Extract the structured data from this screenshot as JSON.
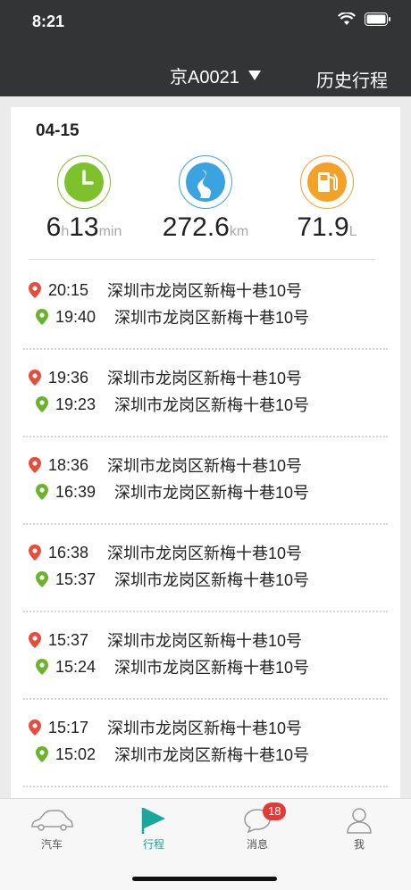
{
  "status": {
    "time": "8:21"
  },
  "header": {
    "vehicle": "京A0021",
    "history": "历史行程"
  },
  "summary": {
    "date": "04-15",
    "duration_h": "6",
    "duration_h_unit": "h",
    "duration_m": "13",
    "duration_m_unit": "min",
    "distance": "272.6",
    "distance_unit": "km",
    "fuel": "71.9",
    "fuel_unit": "L"
  },
  "trips": [
    {
      "end_time": "20:15",
      "end_addr": "深圳市龙岗区新梅十巷10号",
      "start_time": "19:40",
      "start_addr": "深圳市龙岗区新梅十巷10号"
    },
    {
      "end_time": "19:36",
      "end_addr": "深圳市龙岗区新梅十巷10号",
      "start_time": "19:23",
      "start_addr": "深圳市龙岗区新梅十巷10号"
    },
    {
      "end_time": "18:36",
      "end_addr": "深圳市龙岗区新梅十巷10号",
      "start_time": "16:39",
      "start_addr": "深圳市龙岗区新梅十巷10号"
    },
    {
      "end_time": "16:38",
      "end_addr": "深圳市龙岗区新梅十巷10号",
      "start_time": "15:37",
      "start_addr": "深圳市龙岗区新梅十巷10号"
    },
    {
      "end_time": "15:37",
      "end_addr": "深圳市龙岗区新梅十巷10号",
      "start_time": "15:24",
      "start_addr": "深圳市龙岗区新梅十巷10号"
    },
    {
      "end_time": "15:17",
      "end_addr": "深圳市龙岗区新梅十巷10号",
      "start_time": "15:02",
      "start_addr": "深圳市龙岗区新梅十巷10号"
    }
  ],
  "tabs": {
    "car": "汽车",
    "trip": "行程",
    "messages": "消息",
    "messages_badge": "18",
    "me": "我"
  },
  "colors": {
    "header_bg": "#333436",
    "accent": "#1aa79d",
    "clock": "#7dc12d",
    "road": "#3aa4e0",
    "fuel": "#f4a12a",
    "end_pin": "#e74c3c",
    "start_pin": "#6ab42d"
  }
}
